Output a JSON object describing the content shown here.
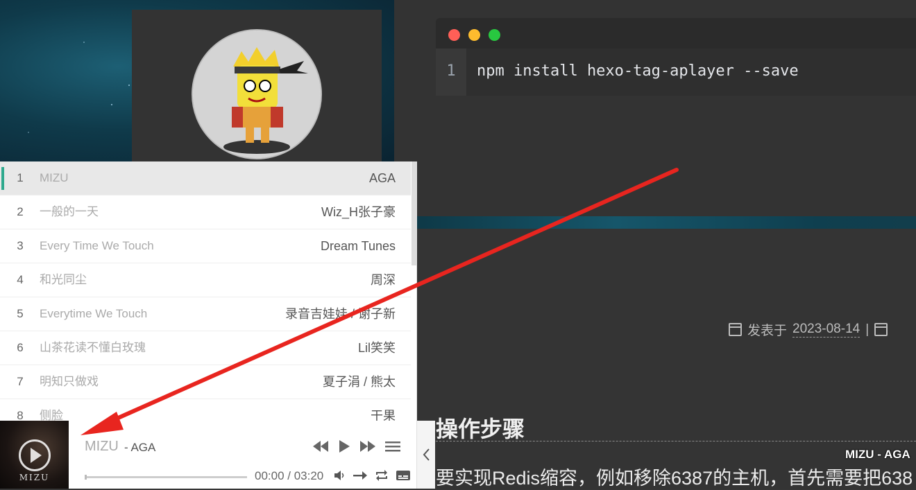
{
  "code_block": {
    "line_number": "1",
    "code": "npm install hexo-tag-aplayer --save",
    "dot_colors": [
      "#ff5f57",
      "#febc2e",
      "#28c840"
    ]
  },
  "post_meta": {
    "label": "发表于",
    "date": "2023-08-14",
    "separator": "|"
  },
  "article": {
    "heading": "操作步骤",
    "paragraph": "要实现Redis缩容，例如移除6387的主机，首先需要把638"
  },
  "lyric_overlay": "MIZU - AGA",
  "player": {
    "accent_color": "#2fa98e",
    "playlist": [
      {
        "num": "1",
        "title": "MIZU",
        "artist": "AGA"
      },
      {
        "num": "2",
        "title": "一般的一天",
        "artist": "Wiz_H张子豪"
      },
      {
        "num": "3",
        "title": "Every Time We Touch",
        "artist": "Dream Tunes"
      },
      {
        "num": "4",
        "title": "和光同尘",
        "artist": "周深"
      },
      {
        "num": "5",
        "title": "Everytime We Touch",
        "artist": "录音吉娃娃 / 谢子新"
      },
      {
        "num": "6",
        "title": "山茶花读不懂白玫瑰",
        "artist": "Lil笑笑"
      },
      {
        "num": "7",
        "title": "明知只做戏",
        "artist": "夏子涓 / 熊太"
      },
      {
        "num": "8",
        "title": "侧脸",
        "artist": "干果"
      }
    ],
    "now_playing": {
      "title": "MIZU",
      "artist": " - AGA",
      "cover_text": "MIZU",
      "current_time": "00:00",
      "separator": " / ",
      "duration": "03:20",
      "progress": 0
    },
    "icons": [
      "play-circle-icon",
      "prev-icon",
      "play-icon",
      "next-icon",
      "menu-icon",
      "volume-icon",
      "order-icon",
      "loop-icon",
      "lyrics-icon",
      "chevron-left-icon"
    ]
  }
}
